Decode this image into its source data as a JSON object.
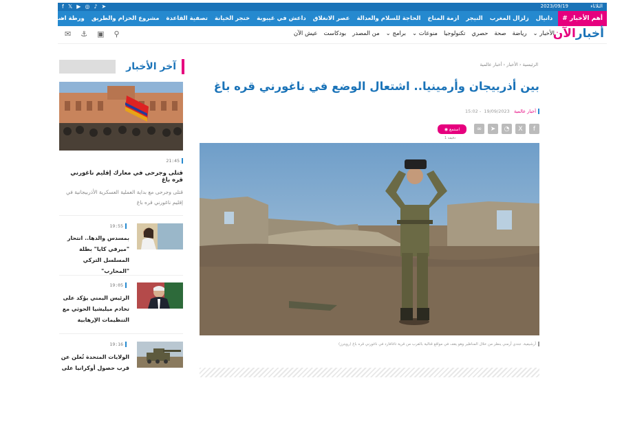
{
  "topbar": {
    "day": "الثلاثاء",
    "date": "2023/09/19",
    "social_icons": [
      "facebook-icon",
      "x-icon",
      "youtube-icon",
      "instagram-icon",
      "tiktok-icon",
      "telegram-icon"
    ]
  },
  "ticker": {
    "badge": "أهم الأخبار #",
    "items": [
      "دانيال",
      "زلزال المغرب",
      "النيجر",
      "أزمة المناخ",
      "الحاجة للسلام والعدالة",
      "عصر الانغلاق",
      "داعش في غيبوبة",
      "خنجر الخيانة",
      "تصفية القاعدة",
      "مشروع الحزام والطريق",
      "ورطة اسمها حقاني"
    ],
    "arrow": "‹"
  },
  "nav": {
    "logo_text": "أخبار",
    "logo_accent": "الآن",
    "items": [
      "الأخبار ⌄",
      "رياضة",
      "صحة",
      "حصري",
      "تكنولوجيا",
      "منوعات ⌄",
      "برامج ⌄",
      "من المصدر",
      "بودكاست",
      "عيش الآن"
    ]
  },
  "article": {
    "breadcrumb": [
      "الرئيسية",
      "الأخبار",
      "أخبار عالمية"
    ],
    "breadcrumb_sep": "‹",
    "title": "بين أذربيجان وأرمينيا.. اشتعال الوضع في ناغورني قره باغ",
    "category": "أخبار عالمية",
    "date": "19/09/2023",
    "time": "15:02",
    "listen_label": "استمع",
    "listen_duration": "1 دقيقة",
    "caption": "أرشيفية. جندي أرمني ينظر من خلال المناظير وهو يقف في مواقع قتالية بالقرب من قرية تاغافارد في ناغورني قره باغ (رويترز)"
  },
  "sidebar": {
    "heading": "آخر الأخبار",
    "featured": {
      "time": "21:45",
      "title": "قتلى وجرحى في معارك إقليم ناغورني قره باغ",
      "excerpt": "قتلى وجرحى مع بداية العملية العسكرية الأذربيجانية في إقليم ناغورني قره باغ"
    },
    "items": [
      {
        "time": "19:55",
        "title": "بمسدس والدها.. انتحار \"ميرفي كايا\" بطلة المسلسل التركي \"المحارب\""
      },
      {
        "time": "19:05",
        "title": "الرئيس اليمني يؤكد على تخادم ميليشيا الحوثي مع التنظيمات الإرهابية"
      },
      {
        "time": "19:16",
        "title": "الولايات المتحدة تُعلن عن قرب حصول أوكرانيا على"
      }
    ]
  },
  "colors": {
    "primary": "#1a73b8",
    "ticker": "#2589cf",
    "accent": "#e6007e"
  }
}
